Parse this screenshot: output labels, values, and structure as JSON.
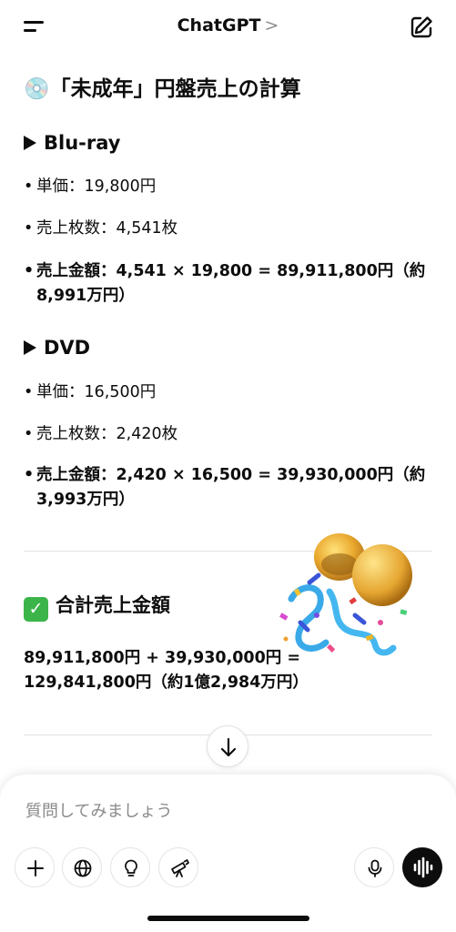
{
  "header": {
    "title": "ChatGPT",
    "chevron": ">"
  },
  "content": {
    "heading": "💿「未成年」円盤売上の計算",
    "bluray": {
      "title": "Blu-ray",
      "unit_price": "単価：19,800円",
      "count": "売上枚数：4,541枚",
      "total": "売上金額：4,541 × 19,800 = 89,911,800円（約8,991万円）"
    },
    "dvd": {
      "title": "DVD",
      "unit_price": "単価：16,500円",
      "count": "売上枚数：2,420枚",
      "total": "売上金額：2,420 × 16,500 = 39,930,000円（約3,993万円）"
    },
    "total_heading": "合計売上金額",
    "total_check_icon": "check-mark-icon",
    "total_line1": "89,911,800円 + 39,930,000円 =",
    "total_line2": "129,841,800円（約1億2,984万円）"
  },
  "composer": {
    "placeholder": "質問してみましょう"
  },
  "colors": {
    "accent_green": "#3bb54a",
    "text": "#0d0d0d",
    "placeholder": "#8a8a8a"
  }
}
